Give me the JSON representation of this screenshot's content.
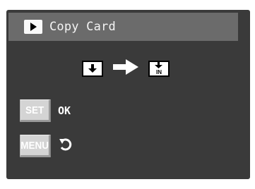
{
  "window": {
    "title": "Copy Card",
    "title_icon": "play-arrow-icon"
  },
  "transfer": {
    "source_icon": "card-download-icon",
    "arrow_icon": "right-arrow-icon",
    "target_icon": "card-in-icon"
  },
  "rows": [
    {
      "key": "SET",
      "label": "OK"
    },
    {
      "key": "MENU",
      "label_icon": "undo-icon"
    }
  ],
  "colors": {
    "frame": "#3a3a3a",
    "titlebar": "#6b6b6b",
    "key_badge": "#d4d4d4",
    "text": "#ffffff"
  }
}
